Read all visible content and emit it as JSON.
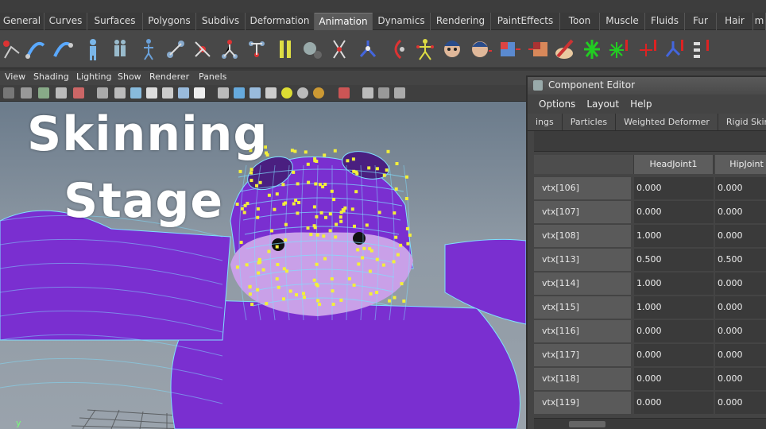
{
  "shelf": {
    "tabs": [
      {
        "label": "General",
        "w": 56
      },
      {
        "label": "Curves",
        "w": 54
      },
      {
        "label": "Surfaces",
        "w": 70
      },
      {
        "label": "Polygons",
        "w": 67
      },
      {
        "label": "Subdivs",
        "w": 62
      },
      {
        "label": "Deformation",
        "w": 87
      },
      {
        "label": "Animation",
        "w": 73,
        "active": true
      },
      {
        "label": "Dynamics",
        "w": 73
      },
      {
        "label": "Rendering",
        "w": 76
      },
      {
        "label": "PaintEffects",
        "w": 87
      },
      {
        "label": "Toon",
        "w": 50
      },
      {
        "label": "Muscle",
        "w": 57
      },
      {
        "label": "Fluids",
        "w": 50
      },
      {
        "label": "Fur",
        "w": 40
      },
      {
        "label": "Hair",
        "w": 46
      },
      {
        "label": "m",
        "w": 16
      }
    ]
  },
  "viewport": {
    "menu": [
      "View",
      "Shading",
      "Lighting",
      "Show",
      "Renderer",
      "Panels"
    ],
    "overlay": {
      "line1": "Skinning",
      "line2": "Stage"
    },
    "axis_label": "y"
  },
  "component_editor": {
    "title": "Component Editor",
    "menu": [
      "Options",
      "Layout",
      "Help"
    ],
    "tabs": [
      "ings",
      "Particles",
      "Weighted Deformer",
      "Rigid Skins"
    ],
    "columns": [
      "HeadJoint1",
      "HipJoint"
    ],
    "rows": [
      {
        "label": "vtx[106]",
        "head": "0.000",
        "hip": "0.000"
      },
      {
        "label": "vtx[107]",
        "head": "0.000",
        "hip": "0.000"
      },
      {
        "label": "vtx[108]",
        "head": "1.000",
        "hip": "0.000"
      },
      {
        "label": "vtx[113]",
        "head": "0.500",
        "hip": "0.500"
      },
      {
        "label": "vtx[114]",
        "head": "1.000",
        "hip": "0.000"
      },
      {
        "label": "vtx[115]",
        "head": "1.000",
        "hip": "0.000"
      },
      {
        "label": "vtx[116]",
        "head": "0.000",
        "hip": "0.000"
      },
      {
        "label": "vtx[117]",
        "head": "0.000",
        "hip": "0.000"
      },
      {
        "label": "vtx[118]",
        "head": "0.000",
        "hip": "0.000"
      },
      {
        "label": "vtx[119]",
        "head": "0.000",
        "hip": "0.000"
      }
    ]
  },
  "colors": {
    "mesh_purple": "#7a2fd0",
    "wire": "#7fe0ff",
    "vertex": "#f3ef3a"
  }
}
